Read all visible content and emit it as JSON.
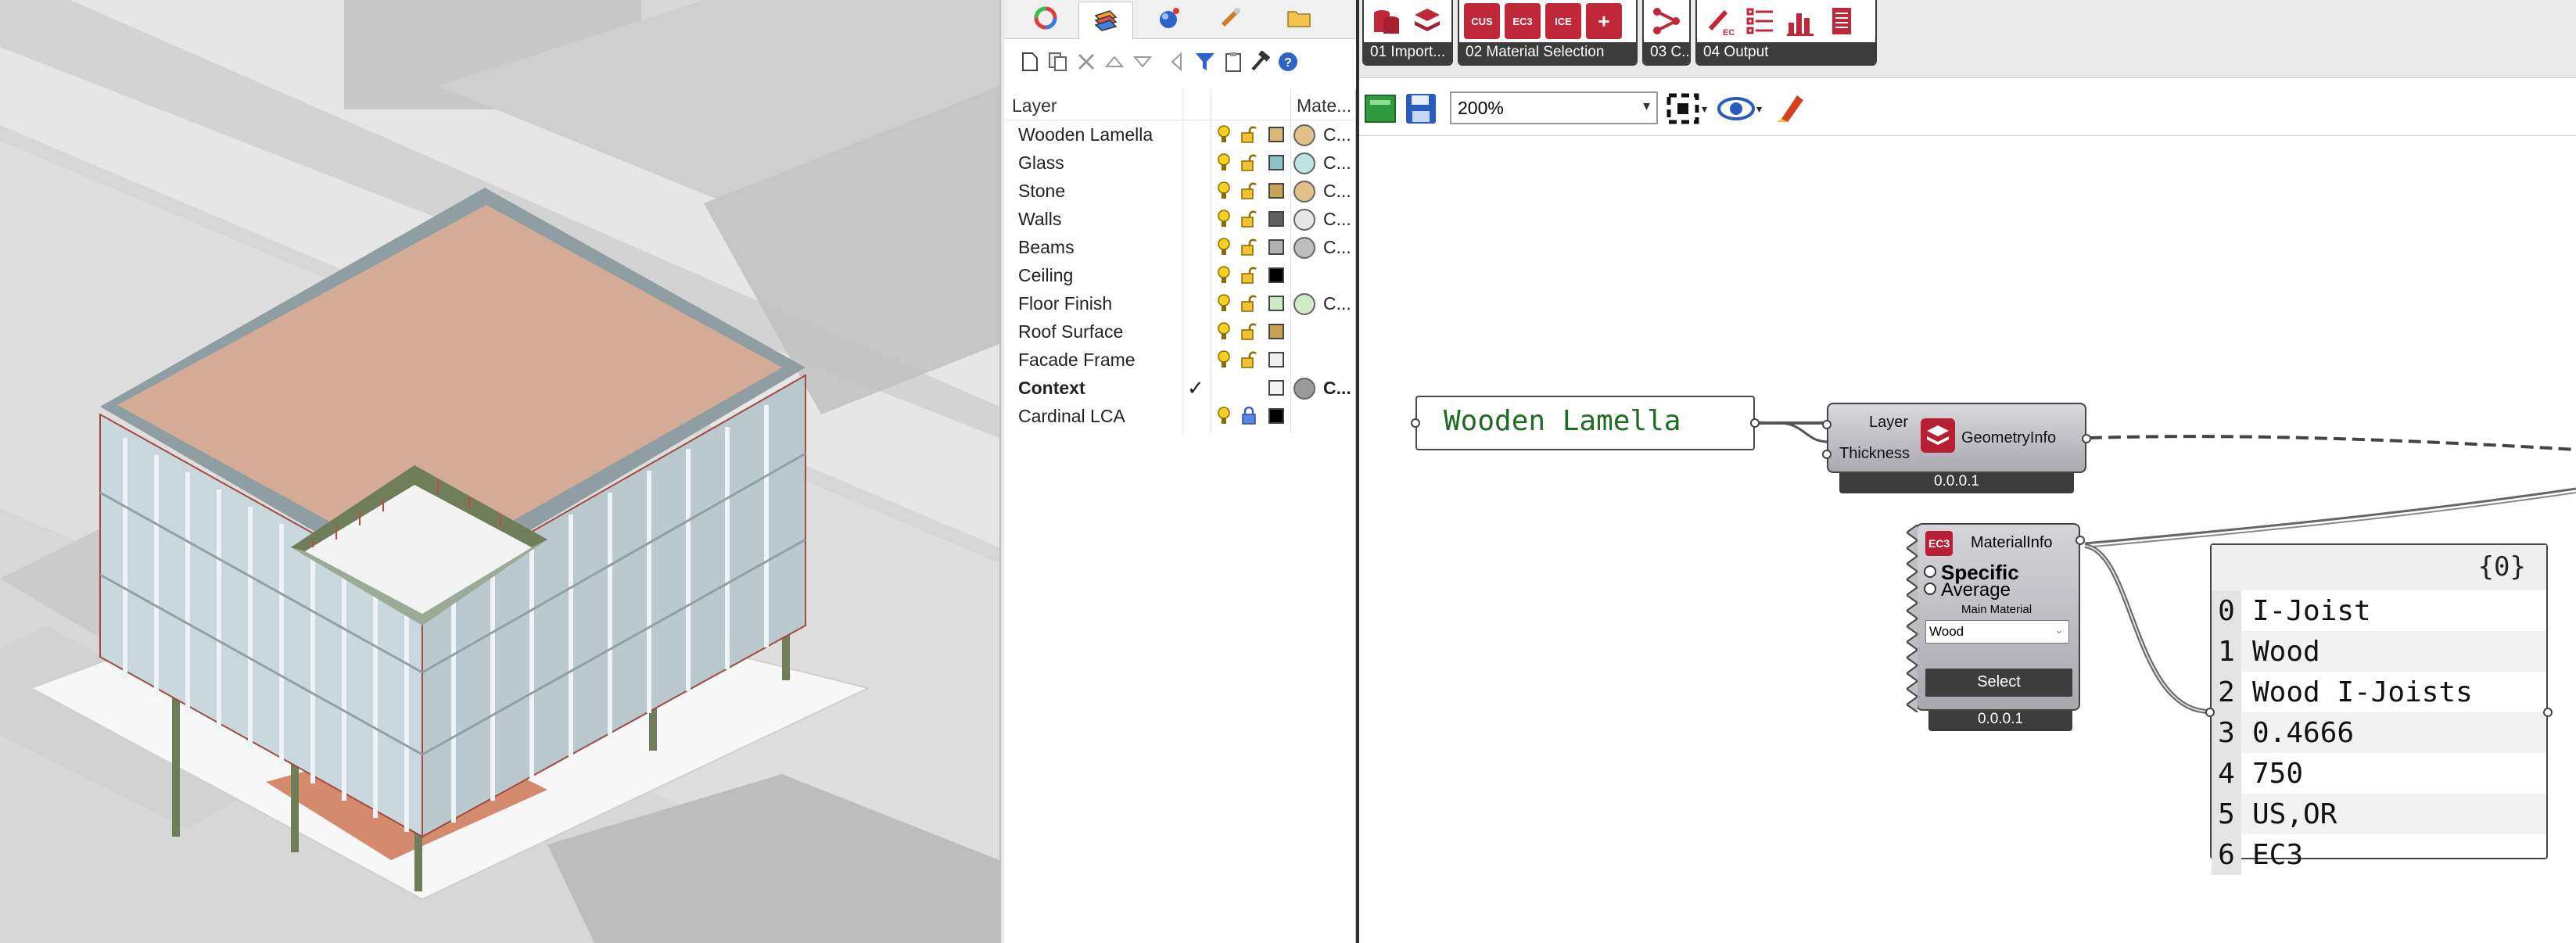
{
  "layer_panel": {
    "tabs": [
      "colors-icon",
      "layers-icon",
      "render-icon",
      "pen-icon",
      "folder-icon"
    ],
    "toolbar_icons": [
      "new-layer-icon",
      "new-sublayer-icon",
      "delete-icon",
      "move-up-icon",
      "move-down-icon",
      "collapse-icon",
      "filter-icon",
      "clipboard-icon",
      "tools-icon",
      "help-icon"
    ],
    "header": {
      "layer": "Layer",
      "material": "Mate..."
    },
    "layers": [
      {
        "name": "Wooden Lamella",
        "color": "#d7b77a",
        "material_color": "#e2c188",
        "material": "C..."
      },
      {
        "name": "Glass",
        "color": "#86c3c2",
        "material_color": "#bfe3e3",
        "material": "C..."
      },
      {
        "name": "Stone",
        "color": "#c9a35a",
        "material_color": "#e2c188",
        "material": "C..."
      },
      {
        "name": "Walls",
        "color": "#606060",
        "material_color": "#e6e6e6",
        "material": "C..."
      },
      {
        "name": "Beams",
        "color": "#b0b0b0",
        "material_color": "#bdbdbd",
        "material": "C..."
      },
      {
        "name": "Ceiling",
        "color": "#000000",
        "material_color": "",
        "material": ""
      },
      {
        "name": "Floor Finish",
        "color": "#cde8c4",
        "material_color": "#d3ecc8",
        "material": "C..."
      },
      {
        "name": "Roof Surface",
        "color": "#c8a052",
        "material_color": "",
        "material": ""
      },
      {
        "name": "Facade Frame",
        "color": "#eeeeee",
        "material_color": "",
        "material": ""
      },
      {
        "name": "Context",
        "color": "#f4f4f4",
        "material_color": "#9a9a9a",
        "material": "C...",
        "current": "✓"
      },
      {
        "name": "Cardinal LCA",
        "color": "#000000",
        "material_color": "",
        "material": ""
      }
    ]
  },
  "gh": {
    "ribbon": [
      {
        "label": "01 Import...",
        "icons": [
          "import-database-icon",
          "layers-icon"
        ]
      },
      {
        "label": "02 Material Selection",
        "icons": [
          "cus-icon",
          "ec3-icon",
          "ice-icon",
          "add-icon"
        ]
      },
      {
        "label": "03 C...",
        "icons": [
          "calculate-icon"
        ]
      },
      {
        "label": "04 Output",
        "icons": [
          "ec-pen-icon",
          "list-icon",
          "bar-chart-icon",
          "report-icon"
        ]
      }
    ],
    "ribbon_icon_text": {
      "cus": "CUS",
      "ec3": "EC3",
      "ice": "ICE",
      "add": "+"
    },
    "zoom": "200%",
    "panel_text": "Wooden Lamella",
    "geometry_node": {
      "title": "GeometryInfo",
      "in1": "Layer",
      "in2": "Thickness",
      "version": "0.0.0.1"
    },
    "material_node": {
      "badge": "EC3",
      "title": "MaterialInfo",
      "opt1": "Specific",
      "opt2": "Average",
      "sub": "Main Material",
      "dropdown": "Wood",
      "button": "Select",
      "version": "0.0.0.1"
    },
    "data_panel": {
      "path": "{0}",
      "rows": [
        {
          "i": "0",
          "v": "I-Joist"
        },
        {
          "i": "1",
          "v": "Wood"
        },
        {
          "i": "2",
          "v": "Wood I-Joists"
        },
        {
          "i": "3",
          "v": "0.4666"
        },
        {
          "i": "4",
          "v": "750"
        },
        {
          "i": "5",
          "v": "US,OR"
        },
        {
          "i": "6",
          "v": "EC3"
        }
      ]
    }
  }
}
